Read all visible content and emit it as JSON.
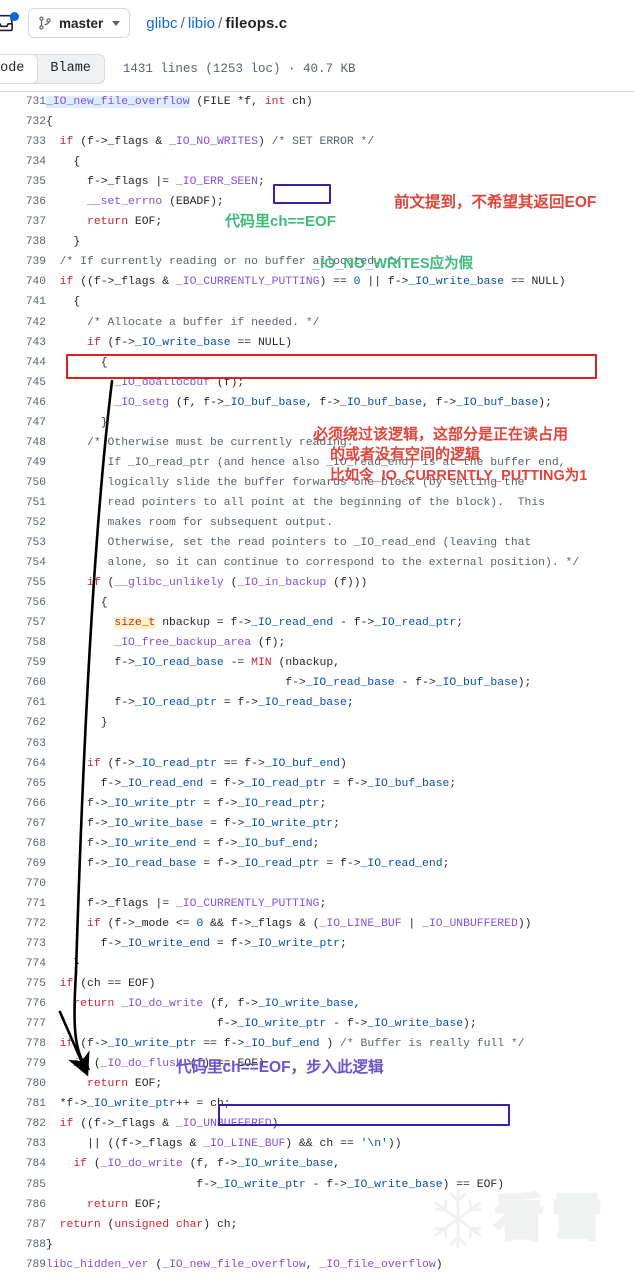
{
  "header": {
    "notif_icon": "inbox-icon",
    "branch_icon": "git-branch-icon",
    "branch_label": "master",
    "breadcrumb": {
      "repo": "glibc",
      "dir": "libio",
      "file": "fileops.c",
      "sep": "/"
    }
  },
  "tabs": {
    "code": "Code",
    "blame": "Blame",
    "fileinfo": "1431 lines (1253 loc) · 40.7 KB"
  },
  "code": {
    "first_line": 731,
    "lines": [
      {
        "n": 731,
        "t": "_IO_new_file_overflow (FILE *f, int ch)"
      },
      {
        "n": 732,
        "t": "{"
      },
      {
        "n": 733,
        "t": "  if (f->_flags & _IO_NO_WRITES) /* SET ERROR */"
      },
      {
        "n": 734,
        "t": "    {"
      },
      {
        "n": 735,
        "t": "      f->_flags |= _IO_ERR_SEEN;"
      },
      {
        "n": 736,
        "t": "      __set_errno (EBADF);"
      },
      {
        "n": 737,
        "t": "      return EOF;"
      },
      {
        "n": 738,
        "t": "    }"
      },
      {
        "n": 739,
        "t": "  /* If currently reading or no buffer allocated. */"
      },
      {
        "n": 740,
        "t": "  if ((f->_flags & _IO_CURRENTLY_PUTTING) == 0 || f->_IO_write_base == NULL)"
      },
      {
        "n": 741,
        "t": "    {"
      },
      {
        "n": 742,
        "t": "      /* Allocate a buffer if needed. */"
      },
      {
        "n": 743,
        "t": "      if (f->_IO_write_base == NULL)"
      },
      {
        "n": 744,
        "t": "        {"
      },
      {
        "n": 745,
        "t": "          _IO_doallocbuf (f);"
      },
      {
        "n": 746,
        "t": "          _IO_setg (f, f->_IO_buf_base, f->_IO_buf_base, f->_IO_buf_base);"
      },
      {
        "n": 747,
        "t": "        }"
      },
      {
        "n": 748,
        "t": "      /* Otherwise must be currently reading."
      },
      {
        "n": 749,
        "t": "         If _IO_read_ptr (and hence also _IO_read_end) is at the buffer end,"
      },
      {
        "n": 750,
        "t": "         logically slide the buffer forwards one block (by setting the"
      },
      {
        "n": 751,
        "t": "         read pointers to all point at the beginning of the block).  This"
      },
      {
        "n": 752,
        "t": "         makes room for subsequent output."
      },
      {
        "n": 753,
        "t": "         Otherwise, set the read pointers to _IO_read_end (leaving that"
      },
      {
        "n": 754,
        "t": "         alone, so it can continue to correspond to the external position). */"
      },
      {
        "n": 755,
        "t": "      if (__glibc_unlikely (_IO_in_backup (f)))"
      },
      {
        "n": 756,
        "t": "        {"
      },
      {
        "n": 757,
        "t": "          size_t nbackup = f->_IO_read_end - f->_IO_read_ptr;"
      },
      {
        "n": 758,
        "t": "          _IO_free_backup_area (f);"
      },
      {
        "n": 759,
        "t": "          f->_IO_read_base -= MIN (nbackup,"
      },
      {
        "n": 760,
        "t": "                                   f->_IO_read_base - f->_IO_buf_base);"
      },
      {
        "n": 761,
        "t": "          f->_IO_read_ptr = f->_IO_read_base;"
      },
      {
        "n": 762,
        "t": "        }"
      },
      {
        "n": 763,
        "t": ""
      },
      {
        "n": 764,
        "t": "      if (f->_IO_read_ptr == f->_IO_buf_end)"
      },
      {
        "n": 765,
        "t": "        f->_IO_read_end = f->_IO_read_ptr = f->_IO_buf_base;"
      },
      {
        "n": 766,
        "t": "      f->_IO_write_ptr = f->_IO_read_ptr;"
      },
      {
        "n": 767,
        "t": "      f->_IO_write_base = f->_IO_write_ptr;"
      },
      {
        "n": 768,
        "t": "      f->_IO_write_end = f->_IO_buf_end;"
      },
      {
        "n": 769,
        "t": "      f->_IO_read_base = f->_IO_read_ptr = f->_IO_read_end;"
      },
      {
        "n": 770,
        "t": ""
      },
      {
        "n": 771,
        "t": "      f->_flags |= _IO_CURRENTLY_PUTTING;"
      },
      {
        "n": 772,
        "t": "      if (f->_mode <= 0 && f->_flags & (_IO_LINE_BUF | _IO_UNBUFFERED))"
      },
      {
        "n": 773,
        "t": "        f->_IO_write_end = f->_IO_write_ptr;"
      },
      {
        "n": 774,
        "t": "    }"
      },
      {
        "n": 775,
        "t": "  if (ch == EOF)"
      },
      {
        "n": 776,
        "t": "    return _IO_do_write (f, f->_IO_write_base,"
      },
      {
        "n": 777,
        "t": "                         f->_IO_write_ptr - f->_IO_write_base);"
      },
      {
        "n": 778,
        "t": "  if (f->_IO_write_ptr == f->_IO_buf_end ) /* Buffer is really full */"
      },
      {
        "n": 779,
        "t": "    if (_IO_do_flush (f) == EOF)"
      },
      {
        "n": 780,
        "t": "      return EOF;"
      },
      {
        "n": 781,
        "t": "  *f->_IO_write_ptr++ = ch;"
      },
      {
        "n": 782,
        "t": "  if ((f->_flags & _IO_UNBUFFERED)"
      },
      {
        "n": 783,
        "t": "      || ((f->_flags & _IO_LINE_BUF) && ch == '\\n'))"
      },
      {
        "n": 784,
        "t": "    if (_IO_do_write (f, f->_IO_write_base,"
      },
      {
        "n": 785,
        "t": "                      f->_IO_write_ptr - f->_IO_write_base) == EOF)"
      },
      {
        "n": 786,
        "t": "      return EOF;"
      },
      {
        "n": 787,
        "t": "  return (unsigned char) ch;"
      },
      {
        "n": 788,
        "t": "}"
      },
      {
        "n": 789,
        "t": "libc_hidden_ver (_IO_new_file_overflow, _IO_file_overflow)"
      }
    ]
  },
  "annotations": [
    {
      "id": "note-red-top",
      "text": "前文提到，不希望其返回EOF",
      "color": "#e0453b"
    },
    {
      "id": "note-green-1",
      "text": "代码里ch==EOF",
      "color": "#3dbb7b"
    },
    {
      "id": "note-green-2",
      "text": "_IO_NO_WRITES应为假",
      "color": "#3dbb7b"
    },
    {
      "id": "note-red-1",
      "text": "必须绕过该逻辑，这部分是正在读占用",
      "color": "#e0453b"
    },
    {
      "id": "note-red-2",
      "text": "的或者没有空间的逻辑",
      "color": "#e0453b"
    },
    {
      "id": "note-red-3",
      "text": "比如令_IO_CURRENTLY_PUTTING为1",
      "color": "#e0453b"
    },
    {
      "id": "note-purple-1",
      "text": "代码里ch==EOF，步入此逻辑",
      "color": "#6655cc"
    }
  ],
  "boxes": [
    {
      "id": "box-int-ch",
      "color": "#3422a8"
    },
    {
      "id": "box-condition-740",
      "color": "#e02020"
    },
    {
      "id": "box-writeptr-777",
      "color": "#3422a8"
    }
  ],
  "arrow": {
    "id": "flow-arrow",
    "color": "#000000"
  },
  "watermark": {
    "text": "看雪",
    "icon": "snowflake-icon"
  },
  "colors": {
    "accent": "#0969da",
    "red_anno": "#e0453b",
    "green_anno": "#3dbb7b",
    "purple_anno": "#6655cc",
    "red_box": "#e02020",
    "blue_box": "#3422a8"
  }
}
